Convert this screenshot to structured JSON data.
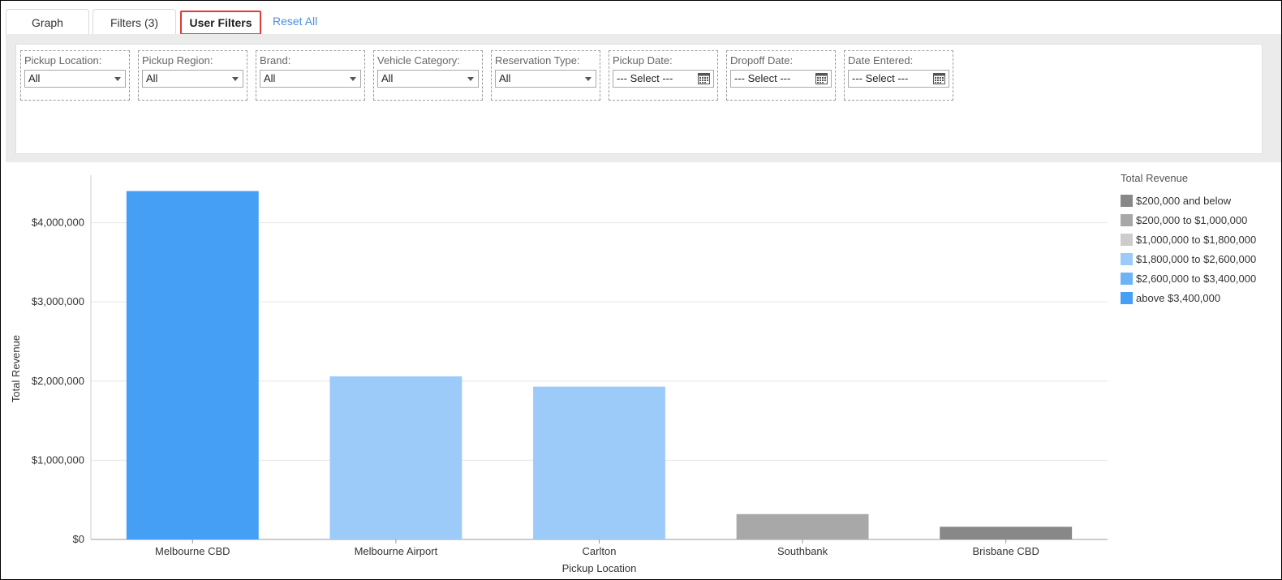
{
  "tabs": {
    "graph": "Graph",
    "filters": "Filters (3)",
    "user_filters": "User Filters",
    "reset_all": "Reset All"
  },
  "filters": [
    {
      "label": "Pickup Location:",
      "value": "All",
      "kind": "select"
    },
    {
      "label": "Pickup Region:",
      "value": "All",
      "kind": "select"
    },
    {
      "label": "Brand:",
      "value": "All",
      "kind": "select"
    },
    {
      "label": "Vehicle Category:",
      "value": "All",
      "kind": "select"
    },
    {
      "label": "Reservation Type:",
      "value": "All",
      "kind": "select"
    },
    {
      "label": "Pickup Date:",
      "value": "--- Select ---",
      "kind": "date"
    },
    {
      "label": "Dropoff Date:",
      "value": "--- Select ---",
      "kind": "date"
    },
    {
      "label": "Date Entered:",
      "value": "--- Select ---",
      "kind": "date"
    }
  ],
  "chart_data": {
    "type": "bar",
    "title": "",
    "xlabel": "Pickup Location",
    "ylabel": "Total Revenue",
    "categories": [
      "Melbourne CBD",
      "Melbourne Airport",
      "Carlton",
      "Southbank",
      "Brisbane CBD"
    ],
    "values": [
      4400000,
      2060000,
      1930000,
      320000,
      160000
    ],
    "bar_colors": [
      "#459ff5",
      "#9dcbf9",
      "#9dcbf9",
      "#a8a8a8",
      "#888888"
    ],
    "ylim": [
      0,
      4600000
    ],
    "yticks": [
      0,
      1000000,
      2000000,
      3000000,
      4000000
    ],
    "ytick_labels": [
      "$0",
      "$1,000,000",
      "$2,000,000",
      "$3,000,000",
      "$4,000,000"
    ],
    "grid": true,
    "legend_position": "right",
    "legend": {
      "title": "Total Revenue",
      "items": [
        {
          "label": "$200,000 and below",
          "color": "#888888"
        },
        {
          "label": "$200,000 to $1,000,000",
          "color": "#a8a8a8"
        },
        {
          "label": "$1,000,000 to $1,800,000",
          "color": "#cccccc"
        },
        {
          "label": "$1,800,000 to $2,600,000",
          "color": "#9dcbf9"
        },
        {
          "label": "$2,600,000 to $3,400,000",
          "color": "#6db4f7"
        },
        {
          "label": "above $3,400,000",
          "color": "#459ff5"
        }
      ]
    }
  },
  "colors": {
    "accent": "#4a90e2",
    "highlight_border": "#e53935"
  }
}
